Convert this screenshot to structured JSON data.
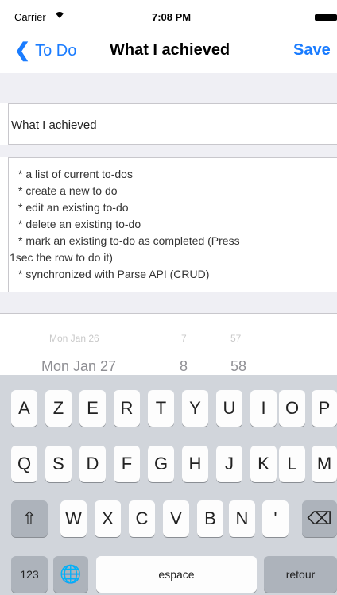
{
  "status_bar": {
    "carrier": "Carrier",
    "wifi_icon": "wifi-icon",
    "time": "7:08 PM",
    "battery_icon": "battery-icon"
  },
  "nav": {
    "back_label": "To Do",
    "title": "What I achieved",
    "save_label": "Save"
  },
  "form": {
    "title_value": "What I achieved",
    "notes_lines": [
      "* a list of current to-dos",
      "* create a new to do",
      "* edit an existing to-do",
      "* delete an existing to-do",
      "* mark an existing to-do as completed (Press",
      "1sec the row to do it)",
      "* synchronized with Parse API (CRUD)"
    ]
  },
  "date_picker": {
    "faded_row": [
      "Mon Jan 26",
      "7",
      "57"
    ],
    "selected_row": [
      "Mon Jan 27",
      "8",
      "58"
    ]
  },
  "keyboard": {
    "row1": [
      "A",
      "Z",
      "E",
      "R",
      "T",
      "Y",
      "U",
      "I",
      "O",
      "P"
    ],
    "row2": [
      "Q",
      "S",
      "D",
      "F",
      "G",
      "H",
      "J",
      "K",
      "L",
      "M"
    ],
    "row3": [
      "W",
      "X",
      "C",
      "V",
      "B",
      "N",
      "'"
    ],
    "shift_icon": "shift-icon",
    "delete_icon": "backspace-icon",
    "numbers_label": "123",
    "globe_icon": "globe-icon",
    "space_label": "espace",
    "return_label": "retour"
  }
}
